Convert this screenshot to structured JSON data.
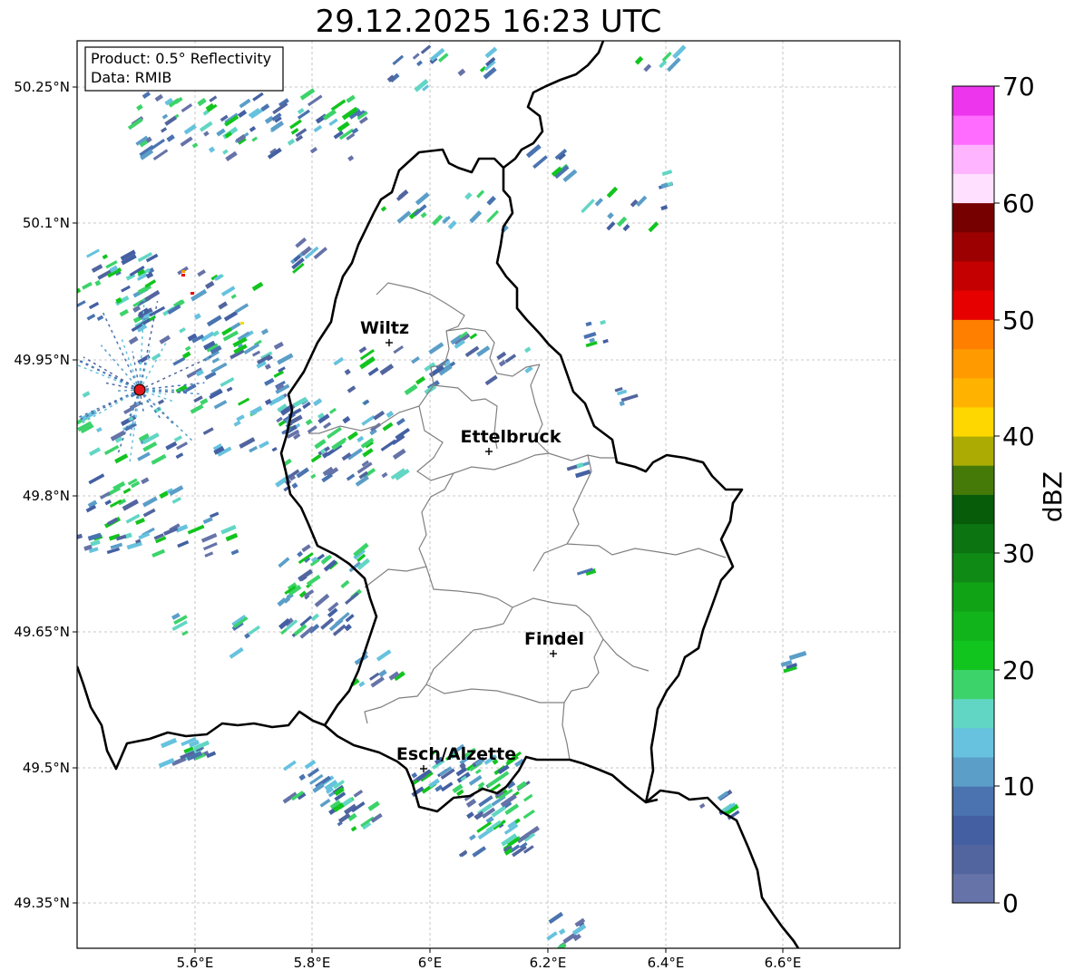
{
  "title": "29.12.2025 16:23 UTC",
  "info": {
    "product": "Product: 0.5° Reflectivity",
    "data": "Data: RMIB"
  },
  "axes": {
    "lon_ticks": [
      "5.6°E",
      "5.8°E",
      "6°E",
      "6.2°E",
      "6.4°E",
      "6.6°E"
    ],
    "lat_ticks": [
      "50.25°N",
      "50.1°N",
      "49.95°N",
      "49.8°N",
      "49.65°N",
      "49.5°N",
      "49.35°N"
    ]
  },
  "cities": [
    {
      "name": "Wiltz"
    },
    {
      "name": "Ettelbruck"
    },
    {
      "name": "Findel"
    },
    {
      "name": "Esch/Alzette"
    }
  ],
  "colorbar": {
    "label": "dBZ",
    "min": 0,
    "max": 70,
    "ticks": [
      "0",
      "10",
      "20",
      "30",
      "40",
      "50",
      "60",
      "70"
    ],
    "colors": [
      "#6673a8",
      "#52659f",
      "#4460a3",
      "#4a73b0",
      "#5b9ec8",
      "#66c2de",
      "#62d6c4",
      "#3cd36a",
      "#12c41e",
      "#11b41b",
      "#10a315",
      "#0f8a14",
      "#0c7410",
      "#075c0a",
      "#457a09",
      "#abab04",
      "#ffd700",
      "#ffb300",
      "#ff9a00",
      "#ff7f00",
      "#e60000",
      "#c40000",
      "#9c0000",
      "#760000",
      "#ffe0ff",
      "#ffb4ff",
      "#ff6cff",
      "#ec35ec"
    ]
  },
  "colors": {
    "border_country": "#000000",
    "border_canton": "#808080",
    "radar_site": "#e4161d"
  }
}
